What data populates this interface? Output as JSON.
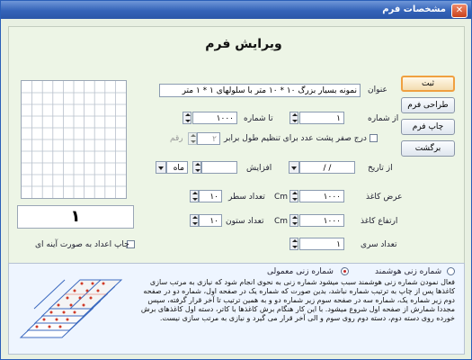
{
  "window": {
    "title": "مشخصات فرم"
  },
  "heading": "ویرایش فرم",
  "fields": {
    "title_label": "عنوان",
    "title_value": "نمونه بسیار بزرگ ۱۰ * ۱۰ متر با سلولهای ۱ * ۱ متر",
    "from_number_label": "از شماره",
    "from_number_value": "۱",
    "to_number_label": "تا شماره",
    "to_number_value": "۱۰۰۰",
    "leading_zero_label": "درج صفر پشت عدد برای تنظیم طول برابر",
    "digits_label": "رقم",
    "digits_value": "۲",
    "from_date_label": "از تاریخ",
    "from_date_value": "/     /",
    "increment_label": "افزایش",
    "period_value": "ماه",
    "paper_width_label": "عرض کاغذ",
    "paper_width_value": "۱۰۰۰",
    "unit": "Cm",
    "row_count_label": "تعداد سطر",
    "row_count_value": "۱۰",
    "paper_height_label": "ارتفاع کاغذ",
    "paper_height_value": "۱۰۰۰",
    "col_count_label": "تعداد ستون",
    "col_count_value": "۱۰",
    "series_count_label": "تعداد سری",
    "series_count_value": "۱"
  },
  "buttons": {
    "save": "ثبت",
    "design": "طراحی فرم",
    "print": "چاپ فرم",
    "back": "برگشت"
  },
  "preview": {
    "page_number": "۱",
    "mirror_label": "چاپ اعداد به صورت آینه ای"
  },
  "numbering": {
    "smart_label": "شماره زنی هوشمند",
    "normal_label": "شماره زنی معمولی",
    "selected": "normal",
    "description": "فعال نمودن شماره زنی هوشمند سبب میشود شماره زنی به نحوی انجام شود که نیازی به مرتب سازی کاغذها پس از چاپ به ترتیب شماره نباشد، بدین صورت که شماره یک در صفحه اول، شماره دو در صفحه دوم زیر شماره یک، شماره سه در صفحه سوم زیر شماره دو و به همین ترتیب تا آخر قرار گرفته، سپس مجددا شمارش از صفحه اول شروع میشود. با این کار هنگام برش کاغذها با کاتر، دسته اول کاغذهای برش خورده روی دسته دوم، دسته دوم روی سوم و الی آخر قرار می گیرد و نیازی به مرتب سازی نیست."
  },
  "colors": {
    "title_bar": "#3463b8",
    "primary_button_border": "#f0a040",
    "window_bg": "#e8f0e2"
  }
}
